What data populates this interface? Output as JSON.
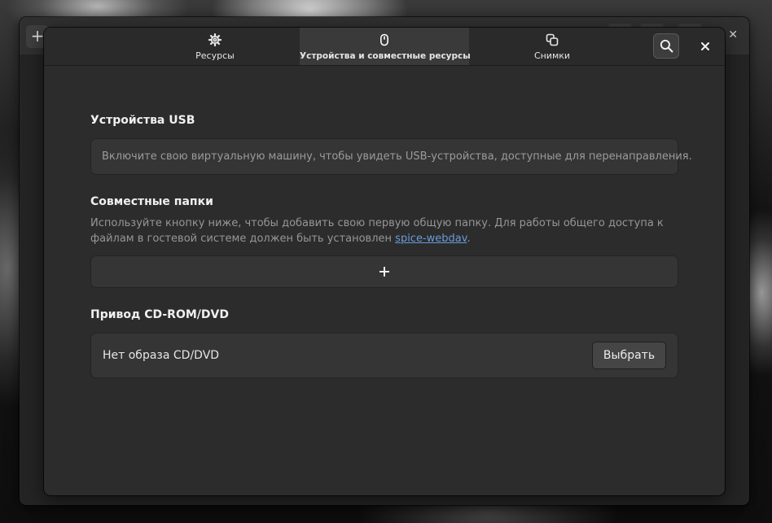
{
  "tabs": [
    {
      "label": "Ресурсы",
      "icon": "gear-icon",
      "active": false
    },
    {
      "label": "Устройства и совместные ресурсы",
      "icon": "mouse-icon",
      "active": true
    },
    {
      "label": "Снимки",
      "icon": "snapshots-icon",
      "active": false
    }
  ],
  "header": {
    "search_icon": "search-icon",
    "close_icon": "close-icon"
  },
  "usb": {
    "title": "Устройства USB",
    "message": "Включите свою виртуальную машину, чтобы увидеть USB-устройства, доступные для перенаправления."
  },
  "shared_folders": {
    "title": "Совместные папки",
    "description_before_link": "Используйте кнопку ниже, чтобы добавить свою первую общую папку. Для работы общего доступа к файлам в гостевой системе должен быть установлен ",
    "link_text": "spice-webdav",
    "description_after_link": ".",
    "add_icon": "plus-icon"
  },
  "cdrom": {
    "title": "Привод CD-ROM/DVD",
    "status": "Нет образа CD/DVD",
    "select_label": "Выбрать"
  },
  "parent_window": {
    "add_icon": "plus-icon",
    "close_icon": "close-icon"
  },
  "colors": {
    "dialog_bg": "#2c2c2c",
    "active_tab_bg": "#3a3a3a",
    "link": "#6a9bd8"
  }
}
